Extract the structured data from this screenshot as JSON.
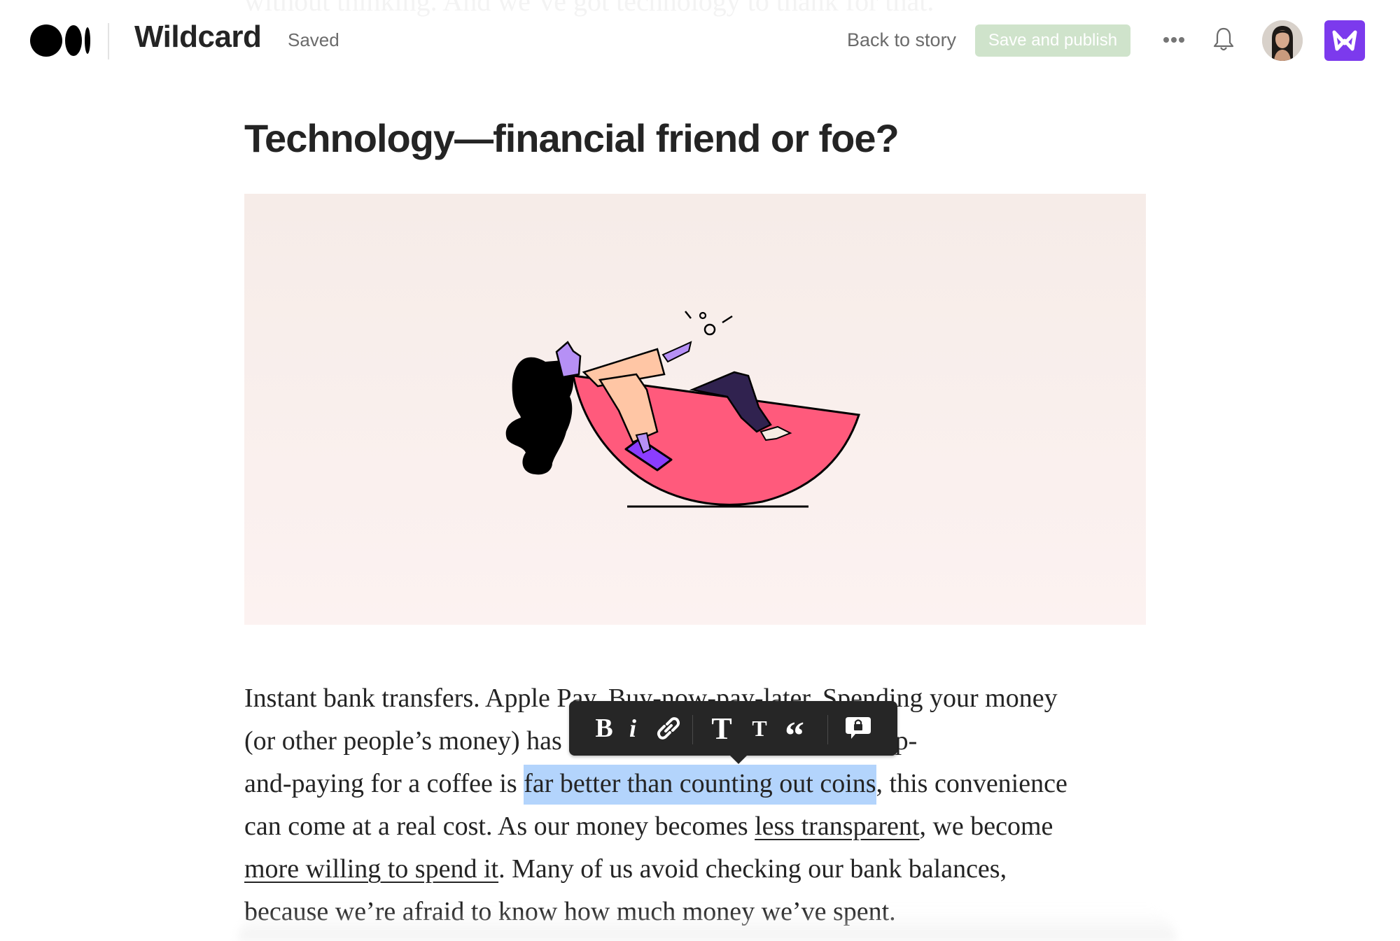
{
  "faded_previous_line": "without thinking. And we’ve got technology to thank for that.",
  "header": {
    "logo": "medium-logo-icon",
    "publication": "Wildcard",
    "status": "Saved",
    "back_link": "Back to story",
    "publish_button": "Save and publish",
    "more_icon": "more-options-icon",
    "notifications_icon": "bell-icon",
    "avatar": "user-avatar",
    "app_icon": "brand-app-icon",
    "colors": {
      "publish_bg": "#cfe3cb",
      "app_bg": "#7c3aed"
    }
  },
  "article": {
    "heading": "Technology—financial friend or foe?",
    "figure": {
      "description": "Illustration of a woman reclining in a pink rocking half-bowl chair holding a purple phone",
      "background": "#f7ede9"
    },
    "paragraph": {
      "l1": "Instant bank transfers. Apple Pay. Buy-now-pay-later. Spending your money",
      "l2_a": "(or other people’s money) has never been easier. But while tap-",
      "l3_a": "and-paying for a coffee is ",
      "l3_sel": "far better than counting out coins",
      "l3_b": ", this convenience",
      "l4_a": "can come at a real cost. As our money becomes ",
      "l4_link": "less transparent",
      "l4_b": ", we become",
      "l5_link": "more willing to spend it",
      "l5_b": ". Many of us avoid checking our bank balances,",
      "l6": "because we’re afraid to know how much money we’ve spent."
    },
    "selection_color": "#b3d4fc"
  },
  "format_toolbar": {
    "bold": "B",
    "italic": "i",
    "link": "link-icon",
    "heading_large": "T",
    "heading_small": "T",
    "quote": "“",
    "private_note": "private-note-icon"
  }
}
